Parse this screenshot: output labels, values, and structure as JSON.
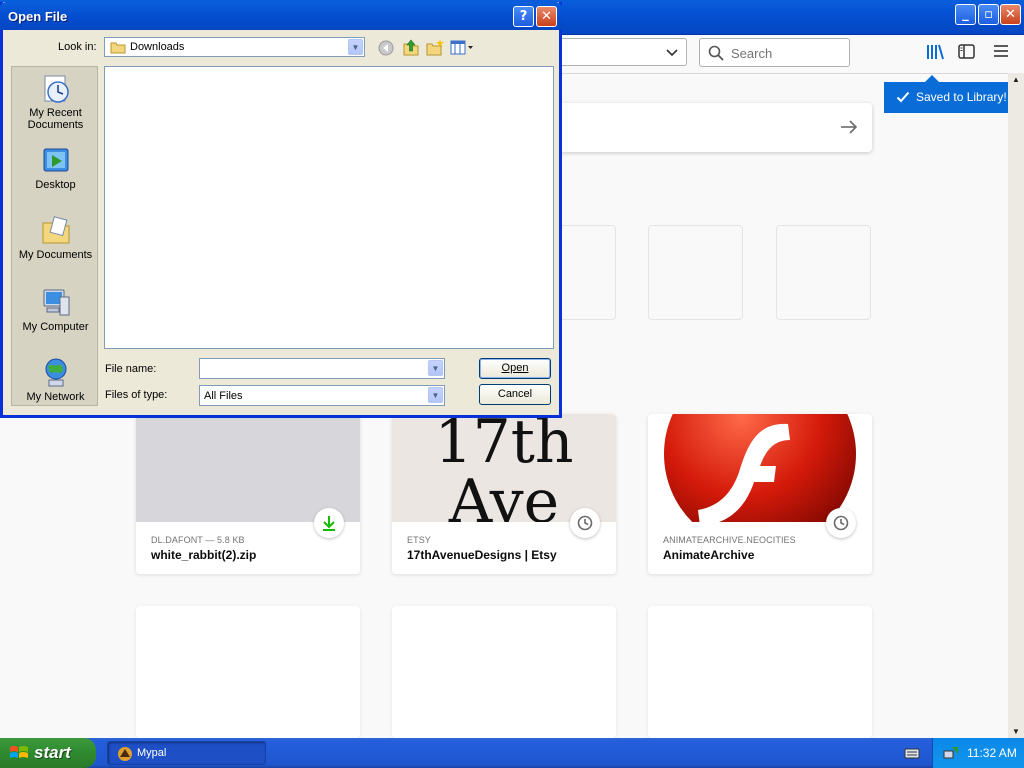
{
  "browser": {
    "search_placeholder": "Search",
    "saved_popup": "Saved to Library!",
    "accent_color": "#0a6cd6",
    "cards": [
      {
        "context": "DL.DAFONT — 5.8 KB",
        "title": "white_rabbit(2).zip",
        "badge": "download-icon"
      },
      {
        "context": "ETSY",
        "title": "17thAvenueDesigns | Etsy",
        "badge": "clock-icon",
        "thumb_line1": "17th",
        "thumb_line2": "Ave"
      },
      {
        "context": "ANIMATEARCHIVE.NEOCITIES",
        "title": "AnimateArchive",
        "badge": "clock-icon"
      }
    ]
  },
  "dialog": {
    "title": "Open File",
    "look_in_label": "Look in:",
    "look_in_value": "Downloads",
    "places": [
      "My Recent Documents",
      "Desktop",
      "My Documents",
      "My Computer",
      "My Network"
    ],
    "file_name_label": "File name:",
    "file_name_value": "",
    "files_of_type_label": "Files of type:",
    "files_of_type_value": "All Files",
    "open_button": "Open",
    "cancel_button": "Cancel"
  },
  "taskbar": {
    "start_label": "start",
    "task_label": "Mypal",
    "clock": "11:32 AM"
  }
}
